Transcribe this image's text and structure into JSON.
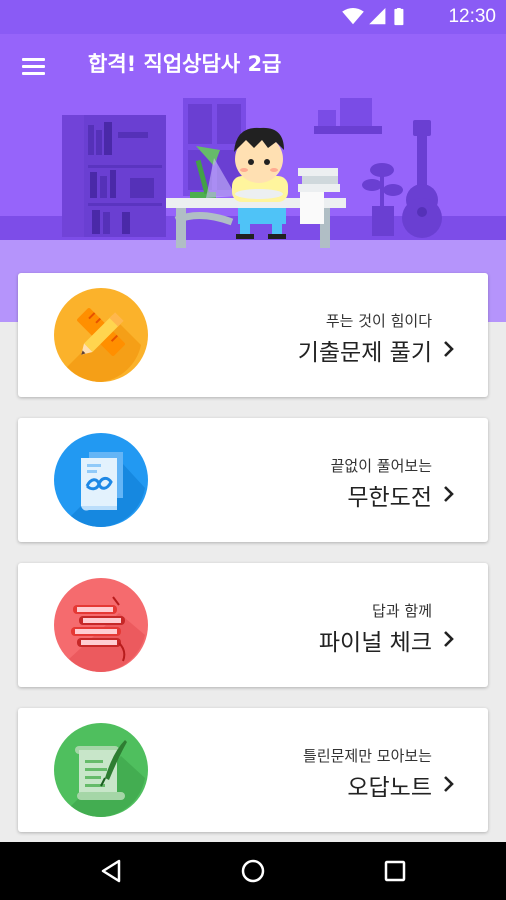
{
  "status_bar": {
    "time": "12:30",
    "icons": [
      "wifi-icon",
      "cellular-signal-icon",
      "battery-icon"
    ]
  },
  "app_bar": {
    "title": "합격! 직업상담사 2급",
    "menu_icon": "hamburger-menu-icon"
  },
  "colors": {
    "primary": "#8a5bf5",
    "hero": "#9664fa",
    "background": "#ececec"
  },
  "menu_cards": [
    {
      "subtitle": "푸는 것이 힘이다",
      "title": "기출문제 풀기",
      "icon": "ruler-pencil-icon",
      "color": "#fbb22b"
    },
    {
      "subtitle": "끝없이 풀어보는",
      "title": "무한도전",
      "icon": "infinity-document-icon",
      "color": "#2299f2"
    },
    {
      "subtitle": "답과 함께",
      "title": "파이널 체크",
      "icon": "stacked-books-icon",
      "color": "#f56b6e"
    },
    {
      "subtitle": "틀린문제만 모아보는",
      "title": "오답노트",
      "icon": "scroll-quill-icon",
      "color": "#4fbf5e"
    }
  ],
  "nav_bar": {
    "buttons": [
      "back-triangle-icon",
      "home-circle-icon",
      "recents-square-icon"
    ]
  }
}
